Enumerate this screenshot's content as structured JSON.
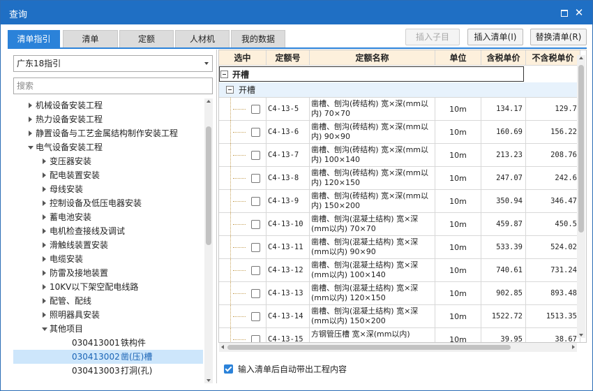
{
  "window": {
    "title": "查询"
  },
  "tabs": [
    "清单指引",
    "清单",
    "定额",
    "人材机",
    "我的数据"
  ],
  "toolbar": {
    "insert_child": "插入子目",
    "insert_list": "插入清单(I)",
    "replace_list": "替换清单(R)"
  },
  "left": {
    "selected_guide": "广东18指引",
    "search_placeholder": "搜索",
    "tree": [
      {
        "label": "机械设备安装工程",
        "level": 1,
        "state": "collapsed"
      },
      {
        "label": "热力设备安装工程",
        "level": 1,
        "state": "collapsed"
      },
      {
        "label": "静置设备与工艺金属结构制作安装工程",
        "level": 1,
        "state": "collapsed"
      },
      {
        "label": "电气设备安装工程",
        "level": 1,
        "state": "expanded"
      },
      {
        "label": "变压器安装",
        "level": 2,
        "state": "collapsed"
      },
      {
        "label": "配电装置安装",
        "level": 2,
        "state": "collapsed"
      },
      {
        "label": "母线安装",
        "level": 2,
        "state": "collapsed"
      },
      {
        "label": "控制设备及低压电器安装",
        "level": 2,
        "state": "collapsed"
      },
      {
        "label": "蓄电池安装",
        "level": 2,
        "state": "collapsed"
      },
      {
        "label": "电机检查接线及调试",
        "level": 2,
        "state": "collapsed"
      },
      {
        "label": "滑触线装置安装",
        "level": 2,
        "state": "collapsed"
      },
      {
        "label": "电缆安装",
        "level": 2,
        "state": "collapsed"
      },
      {
        "label": "防雷及接地装置",
        "level": 2,
        "state": "collapsed"
      },
      {
        "label": "10KV以下架空配电线路",
        "level": 2,
        "state": "collapsed"
      },
      {
        "label": "配管、配线",
        "level": 2,
        "state": "collapsed"
      },
      {
        "label": "照明器具安装",
        "level": 2,
        "state": "collapsed"
      },
      {
        "label": "其他项目",
        "level": 2,
        "state": "expanded"
      },
      {
        "code": "030413001",
        "label": "铁构件",
        "level": 3,
        "state": "leaf"
      },
      {
        "code": "030413002",
        "label": "凿(压)槽",
        "level": 3,
        "state": "leaf",
        "selected": true
      },
      {
        "code": "030413003",
        "label": "打洞(孔)",
        "level": 3,
        "state": "leaf"
      }
    ]
  },
  "grid": {
    "columns": [
      "选中",
      "定额号",
      "定额名称",
      "单位",
      "含税单价",
      "不含税单价"
    ],
    "group1": "开槽",
    "group2": "开槽",
    "rows": [
      {
        "code": "C4-13-5",
        "name": "凿槽、刨沟(砖结构) 宽×深(mm以内) 70×70",
        "unit": "10m",
        "price_tax": "134.17",
        "price_notax": "129.7"
      },
      {
        "code": "C4-13-6",
        "name": "凿槽、刨沟(砖结构) 宽×深(mm以内) 90×90",
        "unit": "10m",
        "price_tax": "160.69",
        "price_notax": "156.22"
      },
      {
        "code": "C4-13-7",
        "name": "凿槽、刨沟(砖结构) 宽×深(mm以内) 100×140",
        "unit": "10m",
        "price_tax": "213.23",
        "price_notax": "208.76"
      },
      {
        "code": "C4-13-8",
        "name": "凿槽、刨沟(砖结构) 宽×深(mm以内) 120×150",
        "unit": "10m",
        "price_tax": "247.07",
        "price_notax": "242.6"
      },
      {
        "code": "C4-13-9",
        "name": "凿槽、刨沟(砖结构) 宽×深(mm以内) 150×200",
        "unit": "10m",
        "price_tax": "350.94",
        "price_notax": "346.47"
      },
      {
        "code": "C4-13-10",
        "name": "凿槽、刨沟(混凝土结构) 宽×深(mm以内) 70×70",
        "unit": "10m",
        "price_tax": "459.87",
        "price_notax": "450.5"
      },
      {
        "code": "C4-13-11",
        "name": "凿槽、刨沟(混凝土结构) 宽×深(mm以内) 90×90",
        "unit": "10m",
        "price_tax": "533.39",
        "price_notax": "524.02"
      },
      {
        "code": "C4-13-12",
        "name": "凿槽、刨沟(混凝土结构) 宽×深(mm以内) 100×140",
        "unit": "10m",
        "price_tax": "740.61",
        "price_notax": "731.24"
      },
      {
        "code": "C4-13-13",
        "name": "凿槽、刨沟(混凝土结构) 宽×深(mm以内) 120×150",
        "unit": "10m",
        "price_tax": "902.85",
        "price_notax": "893.48"
      },
      {
        "code": "C4-13-14",
        "name": "凿槽、刨沟(混凝土结构) 宽×深(mm以内) 150×200",
        "unit": "10m",
        "price_tax": "1522.72",
        "price_notax": "1513.35"
      },
      {
        "code": "C4-13-15",
        "name": "方钢管压槽 宽×深(mm以内)",
        "unit": "10m",
        "price_tax": "39.95",
        "price_notax": "38.67"
      }
    ]
  },
  "footer": {
    "auto_bring_label": "输入清单后自动带出工程内容"
  }
}
